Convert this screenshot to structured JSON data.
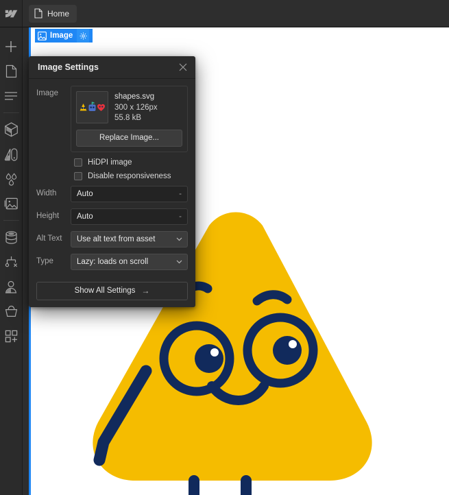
{
  "app": {
    "name": "Webflow Designer",
    "logo_icon": "webflow-logo"
  },
  "topbar": {
    "page_chip": {
      "label": "Home",
      "icon": "page-icon"
    }
  },
  "sidebar": {
    "items": [
      {
        "name": "add-elements",
        "icon": "plus-icon"
      },
      {
        "name": "pages",
        "icon": "page-icon"
      },
      {
        "name": "navigator",
        "icon": "navigator-icon"
      },
      {
        "name": "components",
        "icon": "cube-icon"
      },
      {
        "name": "style-selectors",
        "icon": "style-panel-icon"
      },
      {
        "name": "variables",
        "icon": "droplets-icon"
      },
      {
        "name": "assets",
        "icon": "image-icon"
      },
      {
        "name": "cms",
        "icon": "database-icon"
      },
      {
        "name": "logic",
        "icon": "logic-icon"
      },
      {
        "name": "users",
        "icon": "user-icon"
      },
      {
        "name": "ecommerce",
        "icon": "basket-icon"
      },
      {
        "name": "apps",
        "icon": "apps-grid-icon"
      }
    ]
  },
  "canvas": {
    "selection_badge": {
      "label": "Image",
      "icon": "image-icon",
      "settings_icon": "gear-icon",
      "accent_color": "#1f87f5"
    },
    "artwork": {
      "name": "shapes-character",
      "body_color": "#F5BC00",
      "line_color": "#112A5C"
    }
  },
  "panel": {
    "title": "Image Settings",
    "close_icon": "close-icon",
    "image": {
      "label": "Image",
      "thumbnail_icon": "shapes-thumbnail",
      "filename": "shapes.svg",
      "dimensions": "300 x 126px",
      "filesize": "55.8 kB",
      "replace_button": "Replace Image..."
    },
    "checkboxes": [
      {
        "label": "HiDPI image",
        "checked": false
      },
      {
        "label": "Disable responsiveness",
        "checked": false
      }
    ],
    "fields": [
      {
        "label": "Width",
        "value": "Auto",
        "unit": "-"
      },
      {
        "label": "Height",
        "value": "Auto",
        "unit": "-"
      }
    ],
    "selects": [
      {
        "label": "Alt Text",
        "value": "Use alt text from asset",
        "caret_icon": "chevron-down-icon"
      },
      {
        "label": "Type",
        "value": "Lazy: loads on scroll",
        "caret_icon": "chevron-down-icon"
      }
    ],
    "show_all": {
      "label": "Show All Settings",
      "arrow": "→"
    }
  }
}
